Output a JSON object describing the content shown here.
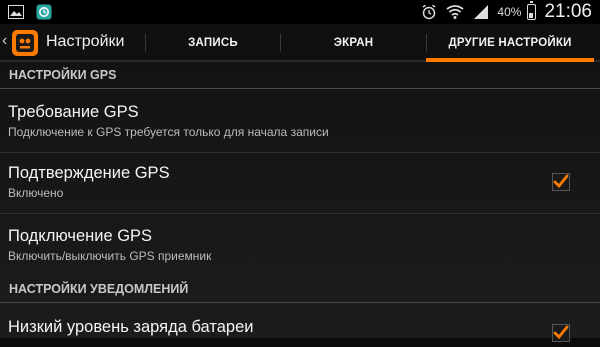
{
  "status_bar": {
    "icons_left": [
      "gallery-icon",
      "app-notification-icon"
    ],
    "icons_right": [
      "alarm-icon",
      "wifi-icon",
      "signal-icon",
      "battery-icon"
    ],
    "battery_percent": "40%",
    "time": "21:06"
  },
  "action_bar": {
    "title": "Настройки",
    "tabs": [
      {
        "label": "ЗАПИСЬ",
        "selected": false
      },
      {
        "label": "ЭКРАН",
        "selected": false
      },
      {
        "label": "ДРУГИЕ НАСТРОЙКИ",
        "selected": true
      }
    ],
    "accent_color": "#ff7a00"
  },
  "sections": {
    "gps": {
      "header": "НАСТРОЙКИ GPS",
      "items": [
        {
          "title": "Требование GPS",
          "summary": "Подключение к GPS требуется только для начала записи",
          "checked": null
        },
        {
          "title": "Подтверждение GPS",
          "summary": "Включено",
          "checked": true
        },
        {
          "title": "Подключение GPS",
          "summary": "Включить/выключить GPS приемник",
          "checked": null
        }
      ]
    },
    "notifications": {
      "header": "НАСТРОЙКИ УВЕДОМЛЕНИЙ",
      "items": [
        {
          "title": "Низкий уровень заряда батареи",
          "summary": "",
          "checked": true
        }
      ]
    }
  }
}
